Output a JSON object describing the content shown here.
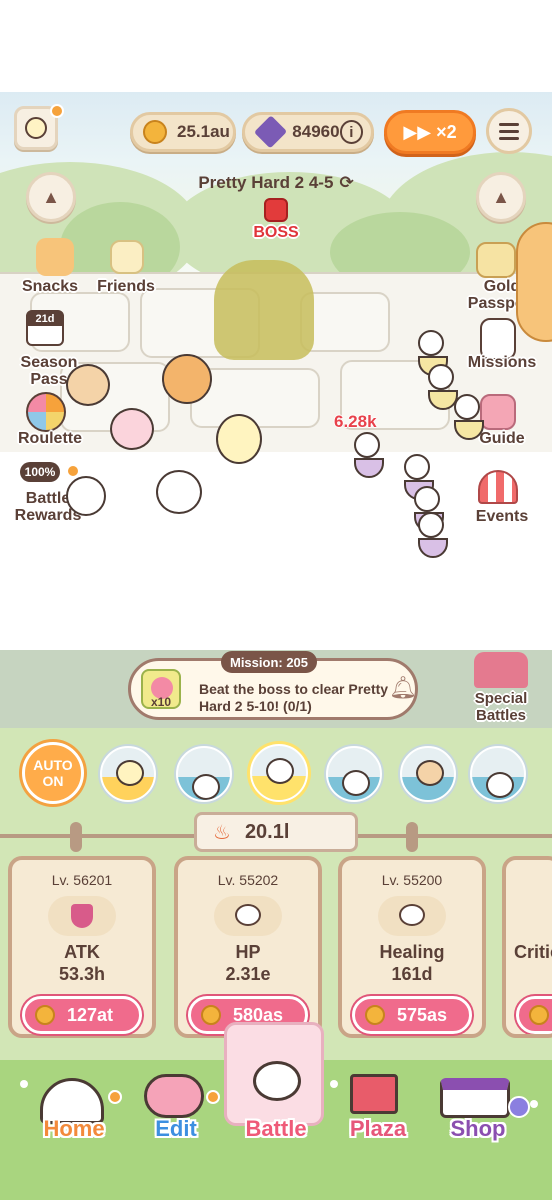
{
  "header": {
    "coins": "25.1au",
    "gems": "84960",
    "info_label": "i",
    "speed_label": "▶▶ ×2"
  },
  "stage": {
    "name": "Pretty Hard 2 4-5",
    "boss_label": "BOSS",
    "damage_popup": "6.28k"
  },
  "left_menu": {
    "snacks": "Snacks",
    "friends": "Friends",
    "season_badge": "21d",
    "season_pass": "Season Pass",
    "roulette": "Roulette",
    "battle_rewards_pct": "100%",
    "battle_rewards": "Battle Rewards"
  },
  "right_menu": {
    "gold_passport": "Gold Passport",
    "missions": "Missions",
    "guide": "Guide",
    "events": "Events"
  },
  "mission": {
    "tag": "Mission: 205",
    "reward_count": "x10",
    "text": "Beat the boss to clear Pretty Hard 2 5-10! (0/1)"
  },
  "special_battles": "Special Battles",
  "auto_button": "AUTO ON",
  "power": "20.1l",
  "upgrades": [
    {
      "level": "Lv. 56201",
      "name": "ATK",
      "value": "53.3h",
      "cost": "127at"
    },
    {
      "level": "Lv. 55202",
      "name": "HP",
      "value": "2.31e",
      "cost": "580as"
    },
    {
      "level": "Lv. 55200",
      "name": "Healing",
      "value": "161d",
      "cost": "575as"
    },
    {
      "name": "Critic"
    }
  ],
  "nav": {
    "home": "Home",
    "edit": "Edit",
    "battle": "Battle",
    "plaza": "Plaza",
    "shop": "Shop"
  },
  "colors": {
    "accent_orange": "#ff9a3c",
    "cost_pink": "#f06b8c",
    "home": "#f38a3b",
    "edit": "#3d8fe0",
    "battle": "#ef5a78",
    "plaza": "#e6577a",
    "shop": "#8b4fb0"
  }
}
